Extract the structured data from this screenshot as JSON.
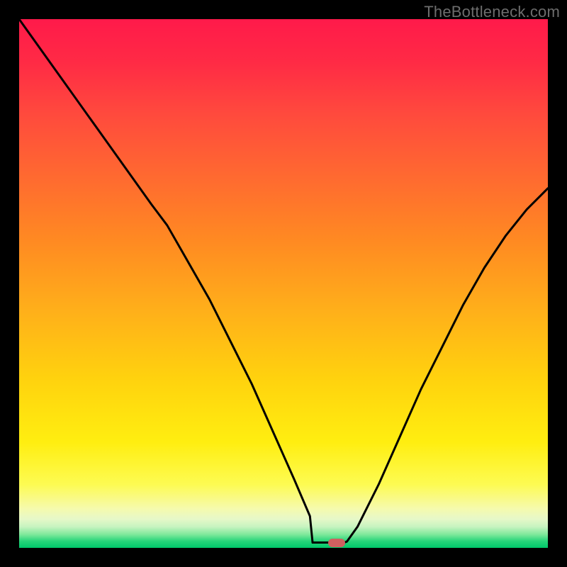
{
  "watermark": "TheBottleneck.com",
  "colors": {
    "frame": "#000000",
    "curve": "#000000",
    "marker": "#d06060"
  },
  "chart_data": {
    "type": "line",
    "title": "",
    "xlabel": "",
    "ylabel": "",
    "xlim": [
      0,
      100
    ],
    "ylim": [
      0,
      100
    ],
    "grid": false,
    "legend": false,
    "description": "Bottleneck-style V curve: y represents bottleneck percentage (high=bad red, low=good green) vs component balance parameter x; background is a vertical red→yellow→green gradient mapping y-value to severity.",
    "series": [
      {
        "name": "bottleneck-curve",
        "x": [
          0,
          5,
          10,
          15,
          20,
          25,
          28,
          32,
          36,
          40,
          44,
          48,
          52,
          55,
          57,
          58.5,
          60,
          61,
          62,
          64,
          68,
          72,
          76,
          80,
          84,
          88,
          92,
          96,
          100
        ],
        "y": [
          100,
          93,
          86,
          79,
          72,
          65,
          61,
          54,
          47,
          39,
          31,
          22,
          13,
          6,
          2,
          1,
          1.0,
          1.0,
          1.2,
          4,
          12,
          21,
          30,
          38,
          46,
          53,
          59,
          64,
          68
        ]
      }
    ],
    "flat_bottom": {
      "x_start": 55.5,
      "x_end": 61.5,
      "y": 1.0
    },
    "marker": {
      "x": 60,
      "y": 1.0
    }
  }
}
